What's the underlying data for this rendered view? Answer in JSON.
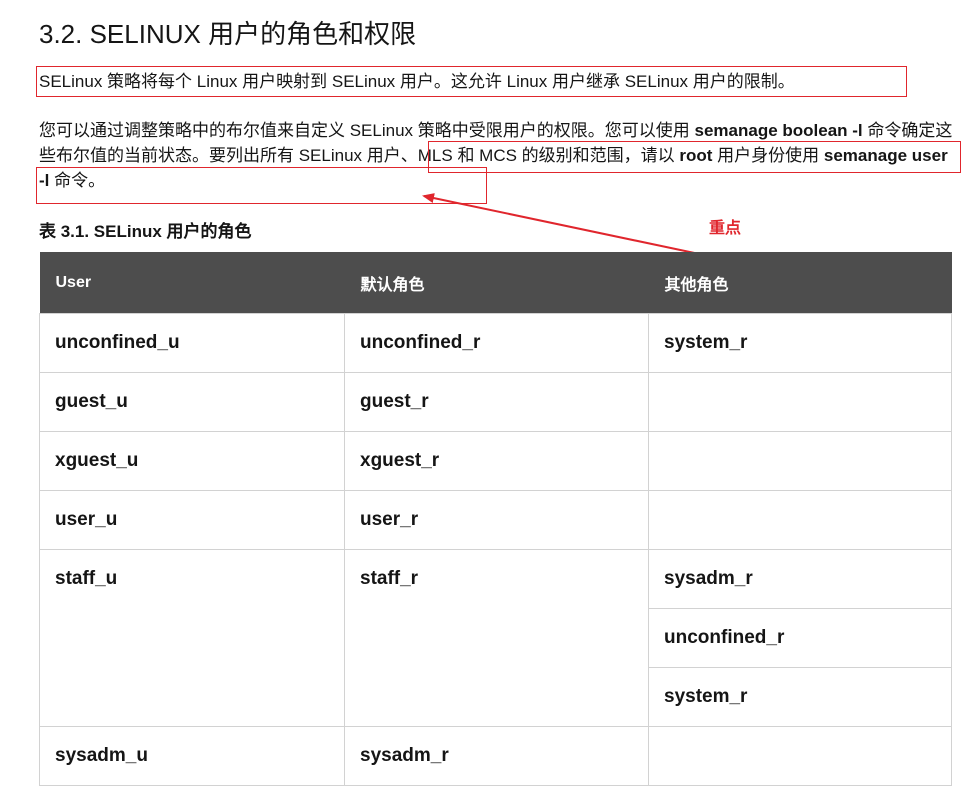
{
  "section": {
    "title": "3.2. SELINUX 用户的角色和权限"
  },
  "paragraph1": "SELinux 策略将每个 Linux 用户映射到 SELinux 用户。这允许 Linux 用户继承 SELinux 用户的限制。",
  "paragraph2": {
    "t1": "您可以通过调整策略中的布尔值来自定义 SELinux 策略中受限用户的权限。您可以使用 ",
    "b1": "semanage boolean -l",
    "t2": " 命令确定这些布尔值的当前状态。要列出所有 SELinux 用户、MLS 和 MCS 的级别和范围，请以 ",
    "b2": "root",
    "t3": " 用户身份使用 ",
    "b3": "semanage user -l",
    "t4": " 命令。"
  },
  "annotation": {
    "label": "重点",
    "color": "#e0262d"
  },
  "table": {
    "caption": "表 3.1. SELinux 用户的角色",
    "headers": [
      "User",
      "默认角色",
      "其他角色"
    ],
    "rows": [
      {
        "user": "unconfined_u",
        "default": "unconfined_r",
        "other": [
          "system_r"
        ]
      },
      {
        "user": "guest_u",
        "default": "guest_r",
        "other": []
      },
      {
        "user": "xguest_u",
        "default": "xguest_r",
        "other": []
      },
      {
        "user": "user_u",
        "default": "user_r",
        "other": []
      },
      {
        "user": "staff_u",
        "default": "staff_r",
        "other": [
          "sysadm_r",
          "unconfined_r",
          "system_r"
        ]
      },
      {
        "user": "sysadm_u",
        "default": "sysadm_r",
        "other": []
      }
    ]
  }
}
